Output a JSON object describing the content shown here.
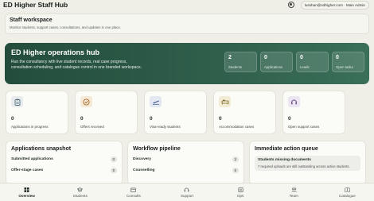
{
  "header": {
    "app_title": "ED Higher Staff Hub",
    "user_chip": "lusshan@edhigher.com · Main Admin"
  },
  "workspace": {
    "title": "Staff workspace",
    "subtitle": "Monitor students, support cases, consultations, and updates in one place."
  },
  "hero": {
    "title": "ED Higher operations hub",
    "description": "Run the consultancy with live student records, real case progress, consultation scheduling, and catalogue control in one branded workspace.",
    "stats": [
      {
        "value": "2",
        "label": "Students"
      },
      {
        "value": "0",
        "label": "Applications"
      },
      {
        "value": "0",
        "label": "Leads"
      },
      {
        "value": "0",
        "label": "Open tasks"
      }
    ]
  },
  "metric_cards": [
    {
      "value": "0",
      "label": "Applications in progress",
      "icon": "clipboard-icon",
      "color": "#e8ecef"
    },
    {
      "value": "0",
      "label": "Offers received",
      "icon": "check-circle-icon",
      "color": "#f6e9d5"
    },
    {
      "value": "0",
      "label": "Visa-ready students",
      "icon": "plane-icon",
      "color": "#e4e8f2"
    },
    {
      "value": "0",
      "label": "Accommodation cases",
      "icon": "bed-icon",
      "color": "#f3ecd5"
    },
    {
      "value": "0",
      "label": "Open support cases",
      "icon": "support-icon",
      "color": "#ece6f2"
    }
  ],
  "panels": {
    "applications": {
      "title": "Applications snapshot",
      "rows": [
        {
          "label": "Submitted applications",
          "count": "0"
        },
        {
          "label": "Offer-stage cases",
          "count": "0"
        }
      ]
    },
    "workflow": {
      "title": "Workflow pipeline",
      "rows": [
        {
          "label": "Discovery",
          "count": "2"
        },
        {
          "label": "Counselling",
          "count": "0"
        }
      ]
    },
    "action_queue": {
      "title": "Immediate action queue",
      "alert_title": "Students missing documents",
      "alert_detail": "7 required uploads are still outstanding across active students."
    }
  },
  "bottom_nav": [
    {
      "label": "Overview",
      "icon": "grid-icon",
      "active": true
    },
    {
      "label": "Students",
      "icon": "students-icon",
      "active": false
    },
    {
      "label": "Consults",
      "icon": "calendar-icon",
      "active": false
    },
    {
      "label": "Support",
      "icon": "support-icon",
      "active": false
    },
    {
      "label": "Ops",
      "icon": "ops-icon",
      "active": false
    },
    {
      "label": "Team",
      "icon": "team-icon",
      "active": false
    },
    {
      "label": "Catalogue",
      "icon": "catalogue-icon",
      "active": false
    }
  ]
}
